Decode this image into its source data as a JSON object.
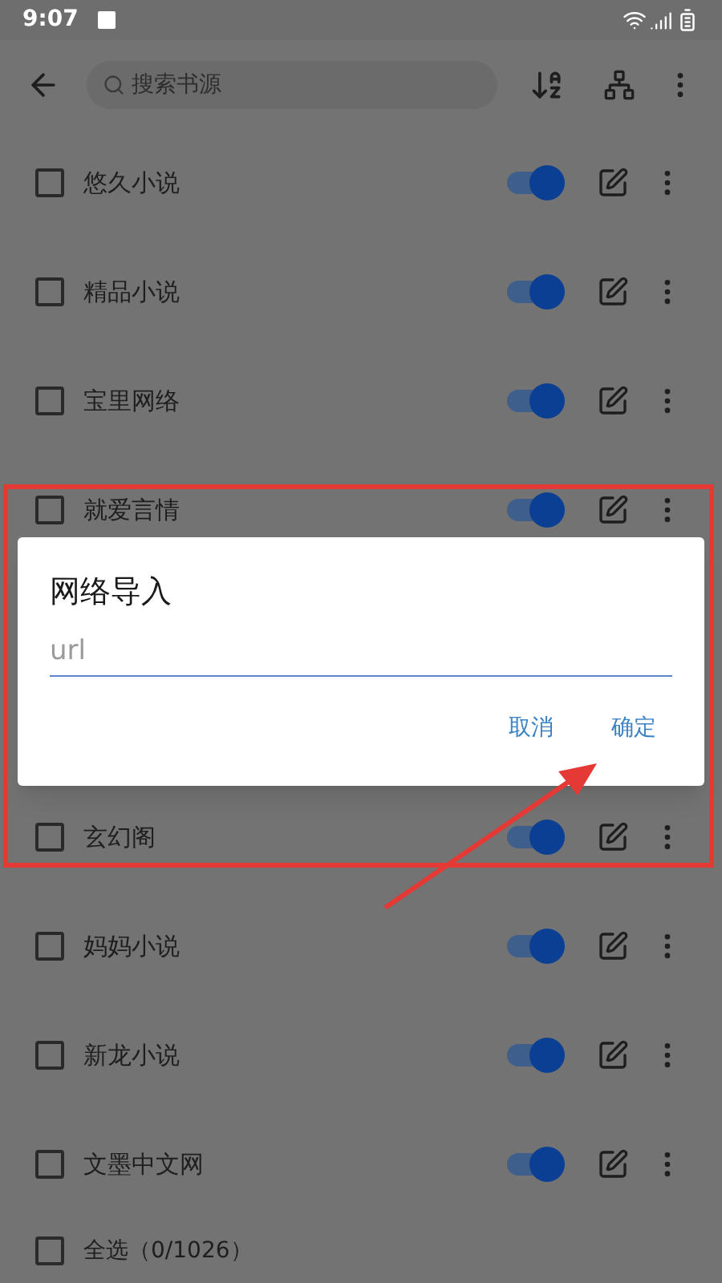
{
  "status_bar": {
    "time": "9:07"
  },
  "toolbar": {
    "search": {
      "placeholder": "搜索书源"
    }
  },
  "sources": [
    {
      "name": "悠久小说",
      "checked": false,
      "enabled": true
    },
    {
      "name": "精品小说",
      "checked": false,
      "enabled": true
    },
    {
      "name": "宝里网络",
      "checked": false,
      "enabled": true
    },
    {
      "name": "就爱言情",
      "checked": false,
      "enabled": true
    },
    {
      "name": "玄幻阁",
      "checked": false,
      "enabled": true
    },
    {
      "name": "妈妈小说",
      "checked": false,
      "enabled": true
    },
    {
      "name": "新龙小说",
      "checked": false,
      "enabled": true
    },
    {
      "name": "文墨中文网",
      "checked": false,
      "enabled": true
    }
  ],
  "bottom_bar": {
    "select_all": {
      "label": "全选（0/1026）",
      "checked": false
    }
  },
  "dialog": {
    "title": "网络导入",
    "input": {
      "placeholder": "url"
    },
    "buttons": [
      "取消",
      "确定"
    ]
  }
}
